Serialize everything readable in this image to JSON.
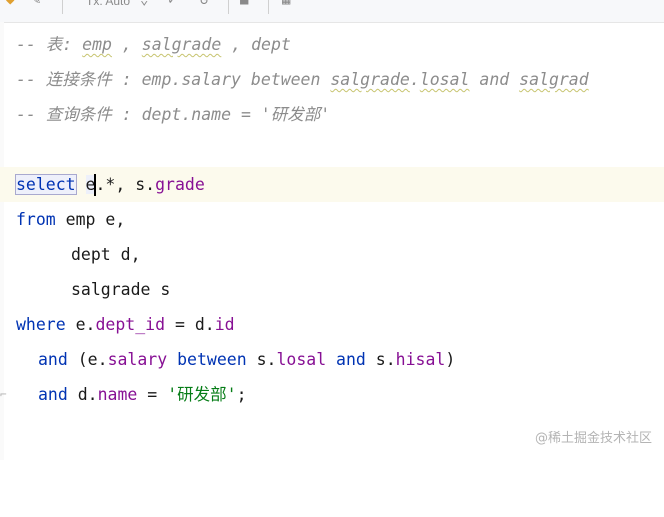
{
  "toolbar": {
    "tx_mode": "Tx: Auto"
  },
  "editor": {
    "comment1": {
      "prefix": "-- 表: ",
      "w1": "emp",
      "sep1": " , ",
      "w2": "salgrade",
      "sep2": " , ",
      "w3": "dept"
    },
    "comment2": {
      "prefix": "-- 连接条件 : ",
      "w1": "emp",
      "mid": ".salary between ",
      "w2": "salgrade",
      "mid2": ".",
      "w3": "losal",
      "mid3": " and ",
      "w4": "salgrad"
    },
    "comment3": {
      "text": "-- 查询条件 : dept.name = '研发部'"
    },
    "select_line": {
      "kw": "select",
      "alias": "e",
      "rest": ".*, s.",
      "field": "grade"
    },
    "from_line": {
      "kw": "from",
      "rest": " emp e,"
    },
    "dept_line": {
      "text": "dept d,"
    },
    "salgrade_line": {
      "text": "salgrade s"
    },
    "where_line": {
      "kw": "where",
      "p1": " e.",
      "field1": "dept_id",
      "p2": " = d.",
      "field2": "id"
    },
    "and1_line": {
      "kw": "and",
      "p1": " (e.",
      "field1": "salary",
      "kw2": " between ",
      "p2": "s.",
      "field2": "losal",
      "kw3": " and ",
      "p3": "s.",
      "field3": "hisal",
      "p4": ")"
    },
    "and2_line": {
      "kw": "and",
      "p1": " d.",
      "field1": "name",
      "p2": " = ",
      "str": "'研发部'",
      "p3": ";"
    }
  },
  "watermark": "@稀土掘金技术社区",
  "colors": {
    "keyword": "#0033b3",
    "field": "#871094",
    "string": "#067d17",
    "comment": "#8c8c8c"
  }
}
